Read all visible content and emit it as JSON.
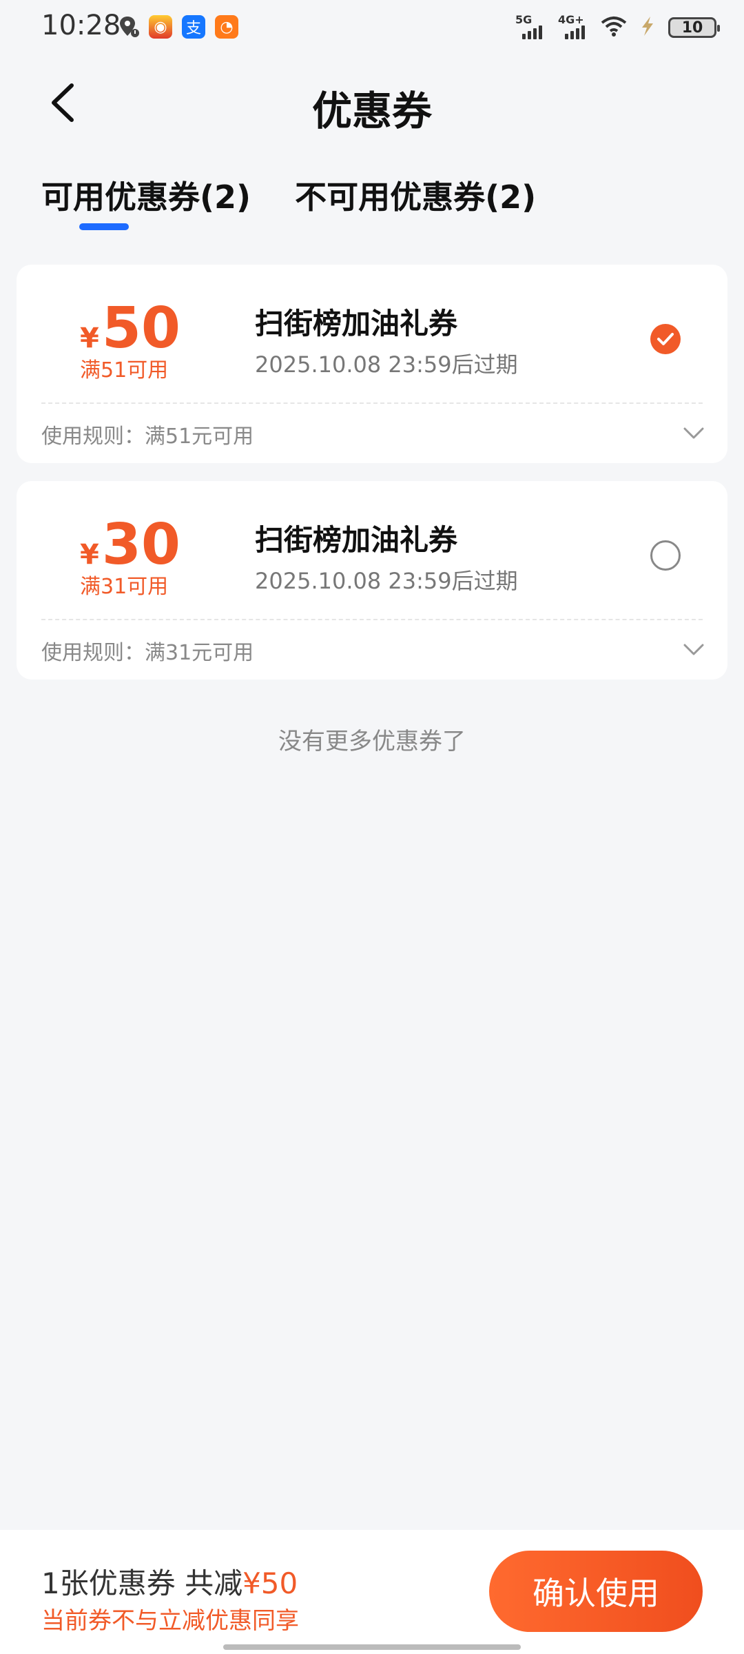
{
  "status_bar": {
    "time": "10:28",
    "signal1_label": "5G",
    "signal2_label": "4G+",
    "battery": "10",
    "app_icons": [
      "location-alert-icon",
      "game-app-icon",
      "alipay-app-icon",
      "orange-app-icon"
    ]
  },
  "header": {
    "title": "优惠券"
  },
  "tabs": [
    {
      "label": "可用优惠券(2)",
      "active": true
    },
    {
      "label": "不可用优惠券(2)",
      "active": false
    }
  ],
  "coupons": [
    {
      "currency": "¥",
      "amount": "50",
      "condition": "满51可用",
      "title": "扫街榜加油礼券",
      "expire": "2025.10.08 23:59后过期",
      "rule": "使用规则：满51元可用",
      "selected": true
    },
    {
      "currency": "¥",
      "amount": "30",
      "condition": "满31可用",
      "title": "扫街榜加油礼券",
      "expire": "2025.10.08 23:59后过期",
      "rule": "使用规则：满31元可用",
      "selected": false
    }
  ],
  "no_more_text": "没有更多优惠券了",
  "footer": {
    "summary_prefix": "1张优惠券 共减",
    "summary_amount": "¥50",
    "notice": "当前券不与立减优惠同享",
    "confirm_label": "确认使用"
  },
  "colors": {
    "accent": "#f15a28",
    "tab_indicator": "#1e6bff",
    "background": "#f5f6f8"
  }
}
